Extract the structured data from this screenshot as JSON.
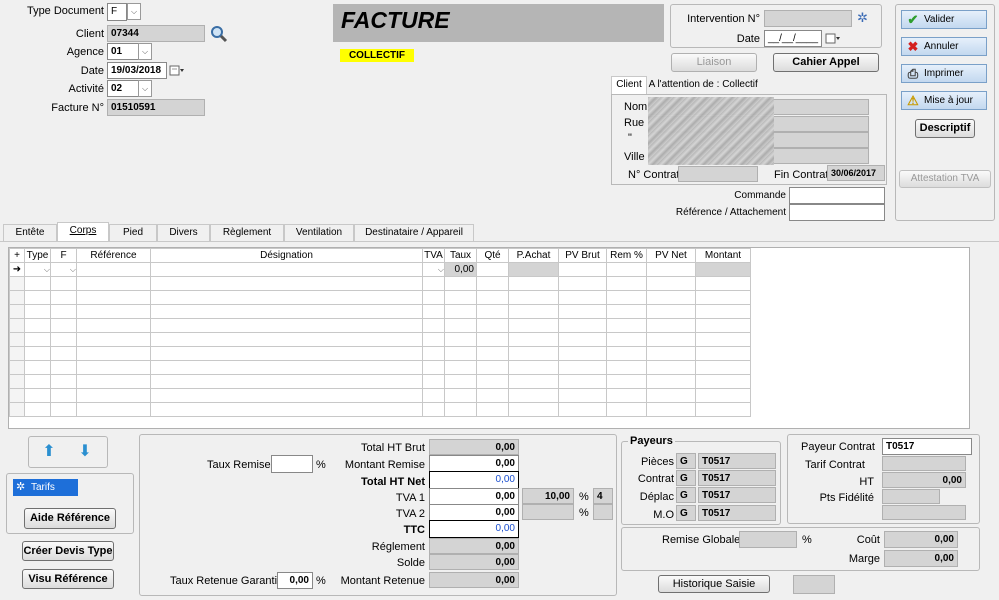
{
  "header": {
    "type_document_label": "Type Document",
    "type_document_value": "F",
    "client_label": "Client",
    "client_value": "07344",
    "agence_label": "Agence",
    "agence_value": "01",
    "date_label": "Date",
    "date_value": "19/03/2018",
    "activite_label": "Activité",
    "activite_value": "02",
    "facture_label": "Facture N°",
    "facture_value": "01510591",
    "title": "FACTURE",
    "collectif": "COLLECTIF",
    "intervention_label": "Intervention N°",
    "intervention_value": "",
    "int_date_label": "Date",
    "int_date_value": "__/__/____",
    "liaison_label": "Liaison",
    "cahier_label": "Cahier Appel"
  },
  "client_tabs": [
    "Client",
    "A l'attention de :",
    "Collectif"
  ],
  "client_block": {
    "nom_label": "Nom",
    "rue_label": "Rue",
    "quote_label": "\"",
    "ville_label": "Ville",
    "contrat_label": "N° Contrat",
    "fin_contrat_label": "Fin Contrat",
    "fin_contrat_value": "30/06/2017",
    "commande_label": "Commande",
    "reference_label": "Référence / Attachement"
  },
  "toolbar": {
    "valider": "Valider",
    "annuler": "Annuler",
    "imprimer": "Imprimer",
    "mise_a_jour": "Mise à jour",
    "descriptif": "Descriptif",
    "attestation": "Attestation TVA"
  },
  "tabs": [
    "Entête",
    "Corps",
    "Pied",
    "Divers",
    "Règlement",
    "Ventilation",
    "Destinataire / Appareil"
  ],
  "grid": {
    "columns": [
      "Type",
      "F",
      "Référence",
      "Désignation",
      "TVA",
      "Taux",
      "Qté",
      "P.Achat",
      "PV Brut",
      "Rem %",
      "PV Net",
      "Montant"
    ],
    "first_row_taux": "0,00"
  },
  "left_bottom": {
    "tarifs": "Tarifs",
    "aide_reference": "Aide Référence",
    "creer_devis": "Créer Devis Type",
    "visu_reference": "Visu Référence"
  },
  "totals": {
    "taux_remise_label": "Taux Remise",
    "percent": "%",
    "total_ht_brut_label": "Total HT Brut",
    "total_ht_brut": "0,00",
    "montant_remise_label": "Montant Remise",
    "montant_remise": "0,00",
    "total_ht_net_label": "Total HT Net",
    "total_ht_net": "0,00",
    "tva1_label": "TVA 1",
    "tva1": "0,00",
    "tva1_rate": "10,00",
    "tva1_code": "4",
    "tva2_label": "TVA 2",
    "tva2": "0,00",
    "ttc_label": "TTC",
    "ttc": "0,00",
    "reglement_label": "Réglement",
    "reglement": "0,00",
    "solde_label": "Solde",
    "solde": "0,00",
    "taux_retenue_label": "Taux Retenue Garantie",
    "taux_retenue": "0,00",
    "montant_retenue_label": "Montant Retenue",
    "montant_retenue": "0,00"
  },
  "payeurs": {
    "title": "Payeurs",
    "rows": [
      {
        "label": "Pièces",
        "g": "G",
        "code": "T0517"
      },
      {
        "label": "Contrat",
        "g": "G",
        "code": "T0517"
      },
      {
        "label": "Déplac",
        "g": "G",
        "code": "T0517"
      },
      {
        "label": "M.O",
        "g": "G",
        "code": "T0517"
      }
    ]
  },
  "contract": {
    "payeur_label": "Payeur Contrat",
    "payeur_value": "T0517",
    "tarif_label": "Tarif Contrat",
    "ht_label": "HT",
    "ht_value": "0,00",
    "pts_label": "Pts Fidélité"
  },
  "remise": {
    "label": "Remise Globale",
    "percent": "%",
    "cout_label": "Coût",
    "cout": "0,00",
    "marge_label": "Marge",
    "marge": "0,00"
  },
  "historique": "Historique Saisie",
  "colors": {
    "title_bg": "#b5b5b5",
    "collectif_bg": "#ffff00",
    "toolbar_bg": "#c3d8ef",
    "tarifs_bg": "#1e6fd9",
    "link_blue": "#1a4fd0"
  }
}
